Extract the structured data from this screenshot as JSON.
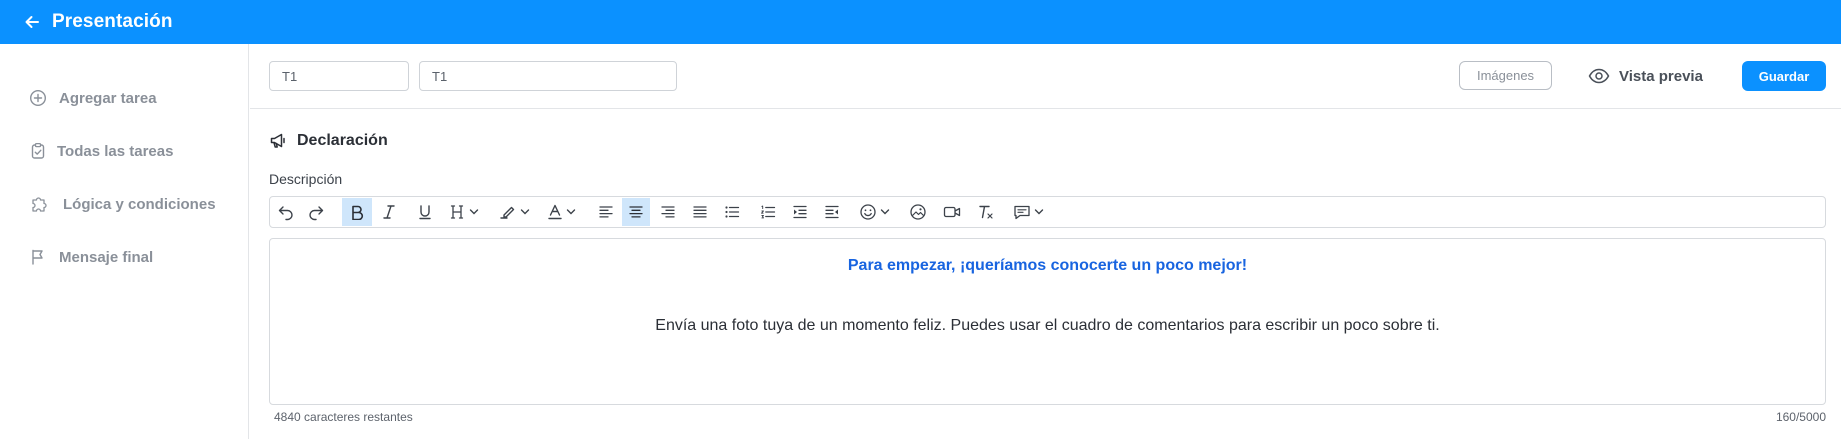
{
  "app": {
    "title": "Presentación",
    "colors": {
      "brand": "#0b91ff",
      "heading_blue": "#1864e0"
    }
  },
  "sidebar": {
    "items": [
      {
        "label": "Agregar tarea",
        "icon": "plus-circle-icon"
      },
      {
        "label": "Todas las tareas",
        "icon": "clipboard-check-icon"
      },
      {
        "label": "Lógica y condiciones",
        "icon": "puzzle-icon"
      },
      {
        "label": "Mensaje final",
        "icon": "flag-icon"
      }
    ]
  },
  "header": {
    "field1": {
      "value": "T1"
    },
    "field2": {
      "value": "T1"
    },
    "images_label": "Imágenes",
    "preview_label": "Vista previa",
    "save_label": "Guardar"
  },
  "section": {
    "title": "Declaración",
    "icon": "megaphone-icon",
    "description_label": "Descripción"
  },
  "toolbar": {
    "tools": [
      "undo",
      "redo",
      "bold",
      "italic",
      "underline",
      "heading",
      "highlight",
      "font-color",
      "align-left",
      "align-center",
      "align-right",
      "align-justify",
      "bullet-list",
      "numbered-list",
      "indent",
      "outdent",
      "emoji",
      "image",
      "video",
      "clear-format",
      "comment"
    ],
    "active": [
      "bold",
      "align-center"
    ]
  },
  "editor": {
    "heading": "Para empezar, ¡queríamos conocerte un poco mejor!",
    "body": "Envía una foto tuya de un momento feliz. Puedes usar el cuadro de comentarios para escribir un poco sobre ti."
  },
  "footer": {
    "remaining": "4840 caracteres restantes",
    "count": "160/5000"
  }
}
